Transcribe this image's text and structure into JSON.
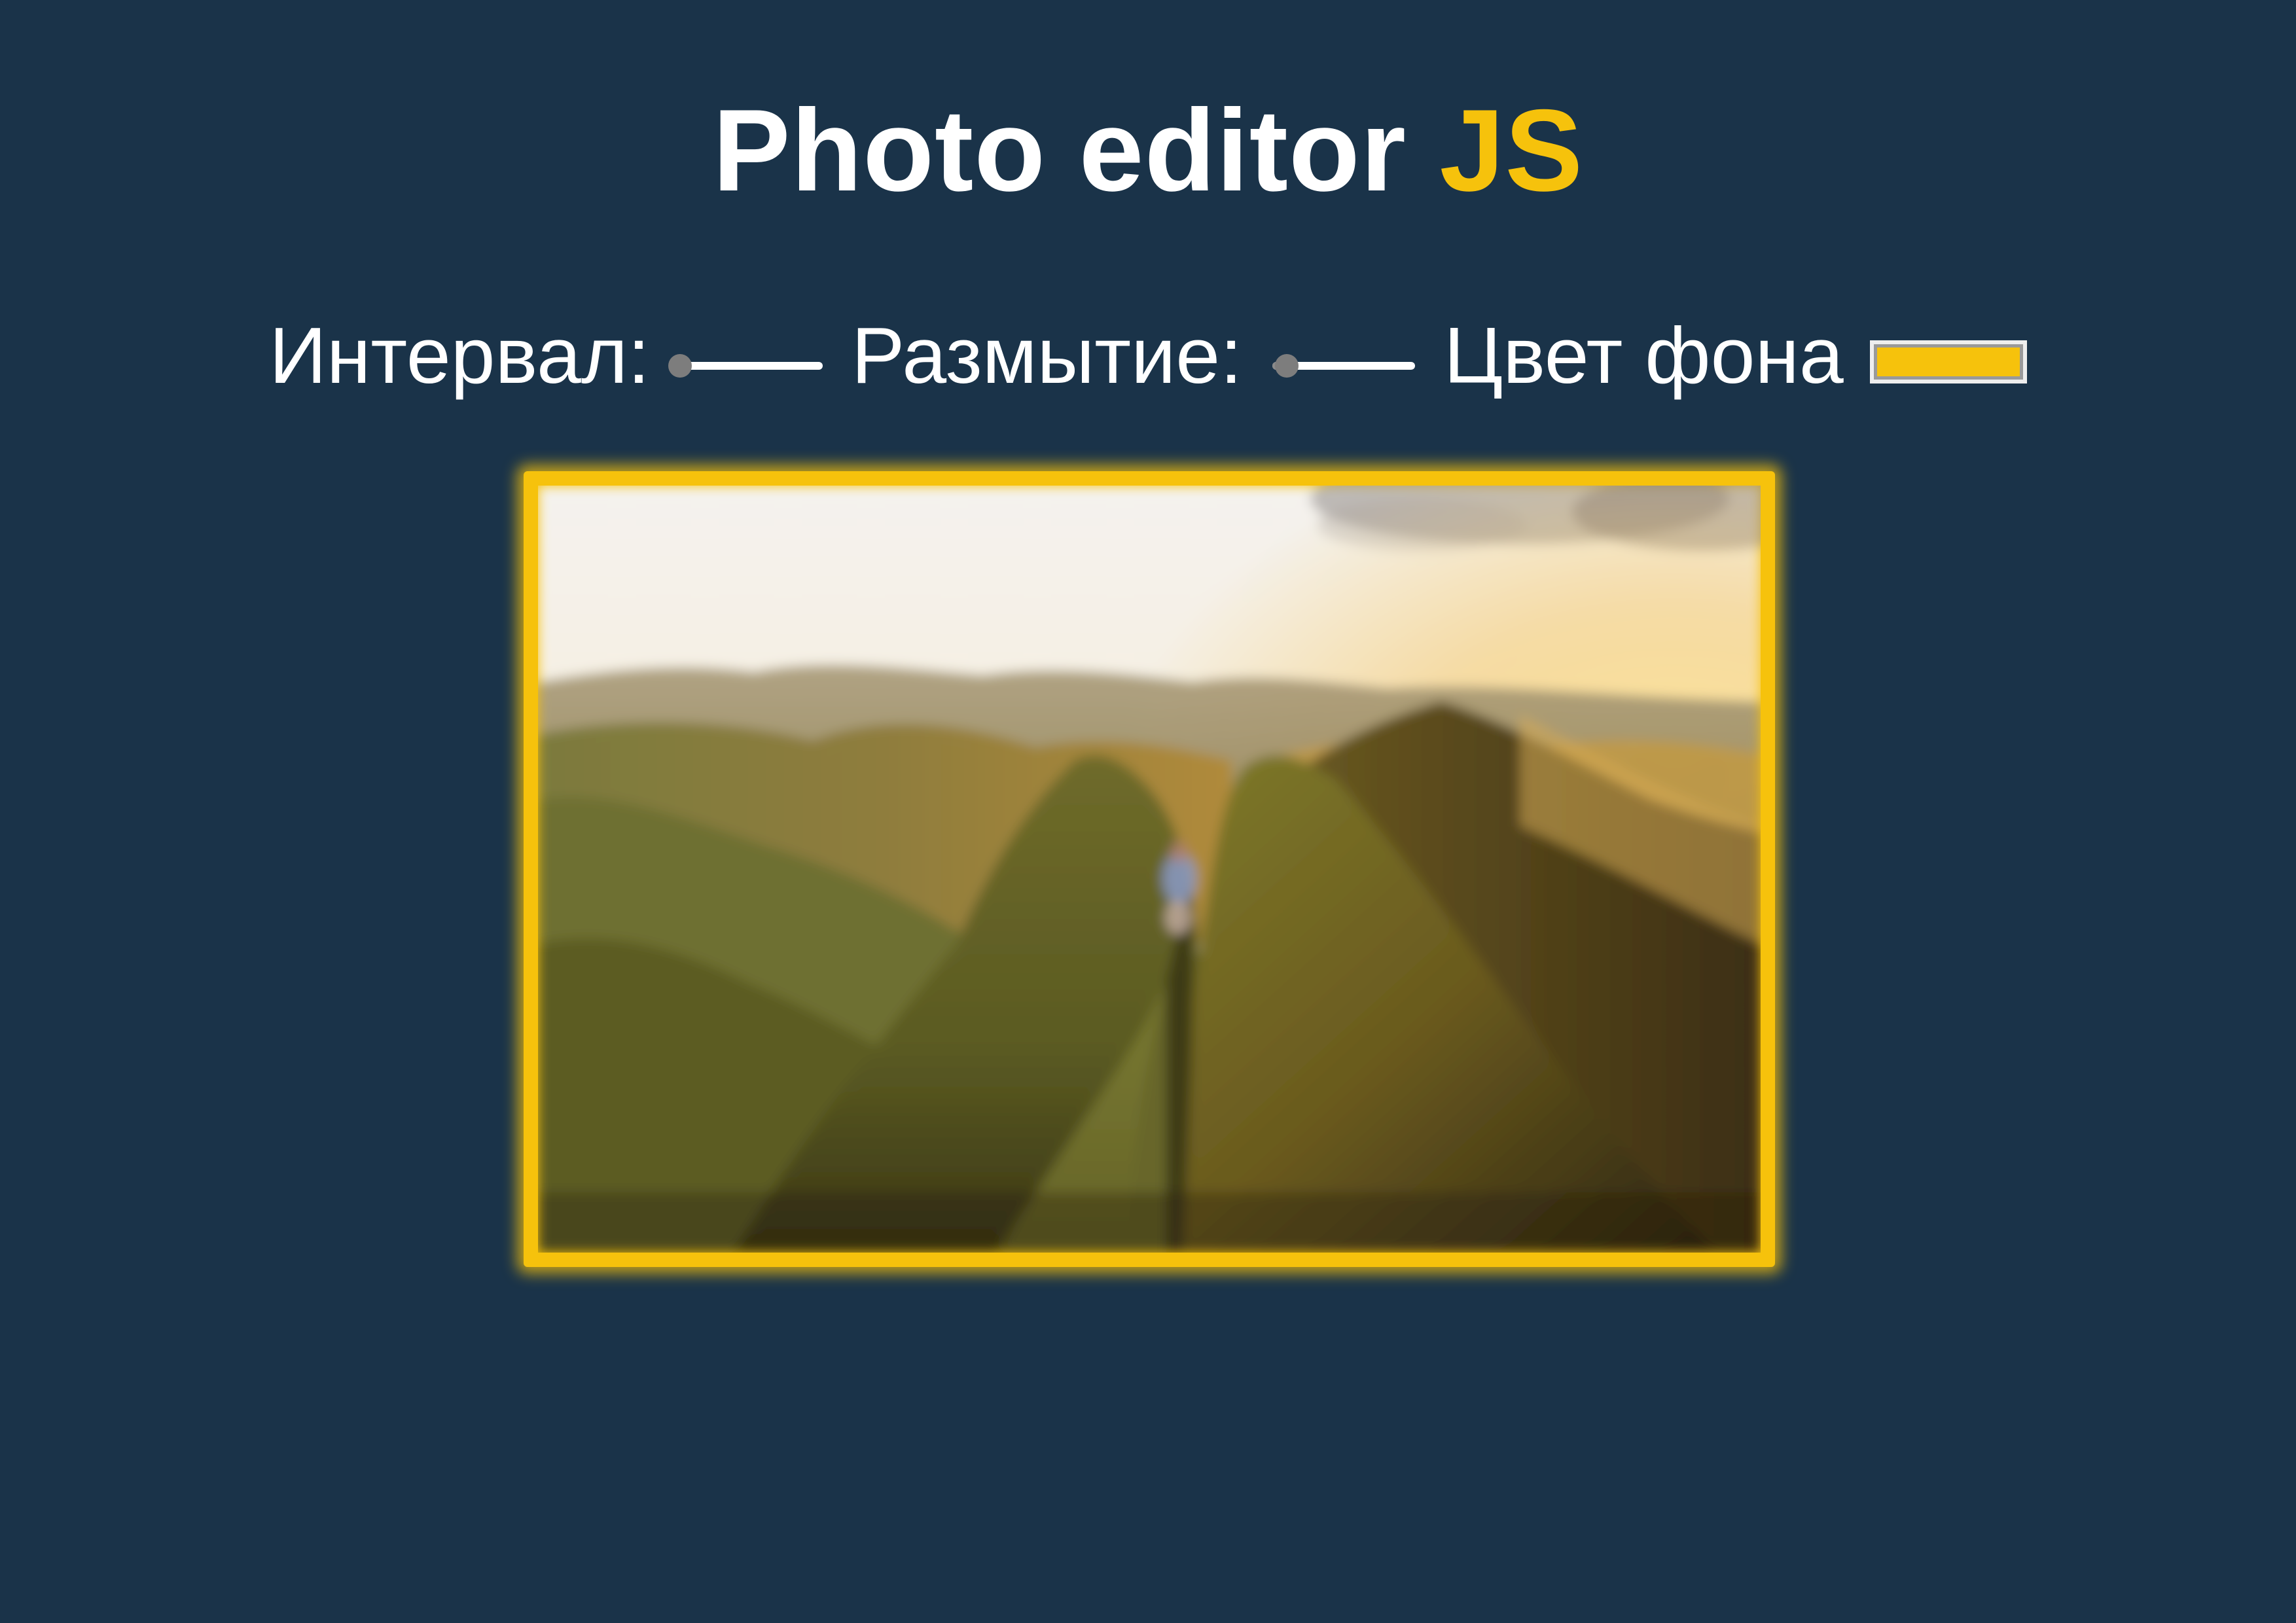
{
  "header": {
    "title_main": "Photo editor ",
    "title_accent": "JS"
  },
  "controls": {
    "spacing": {
      "label": "Интервал:",
      "value": 0,
      "max": 100
    },
    "blur": {
      "label": "Размытие:",
      "value": 10,
      "max": 100
    },
    "background_color": {
      "label": "Цвет фона",
      "value": "#f6c20c"
    }
  },
  "colors": {
    "page_background": "#1a3349",
    "accent": "#f6c20c"
  },
  "image": {
    "subject": "mountain-ridge-at-sunset"
  }
}
